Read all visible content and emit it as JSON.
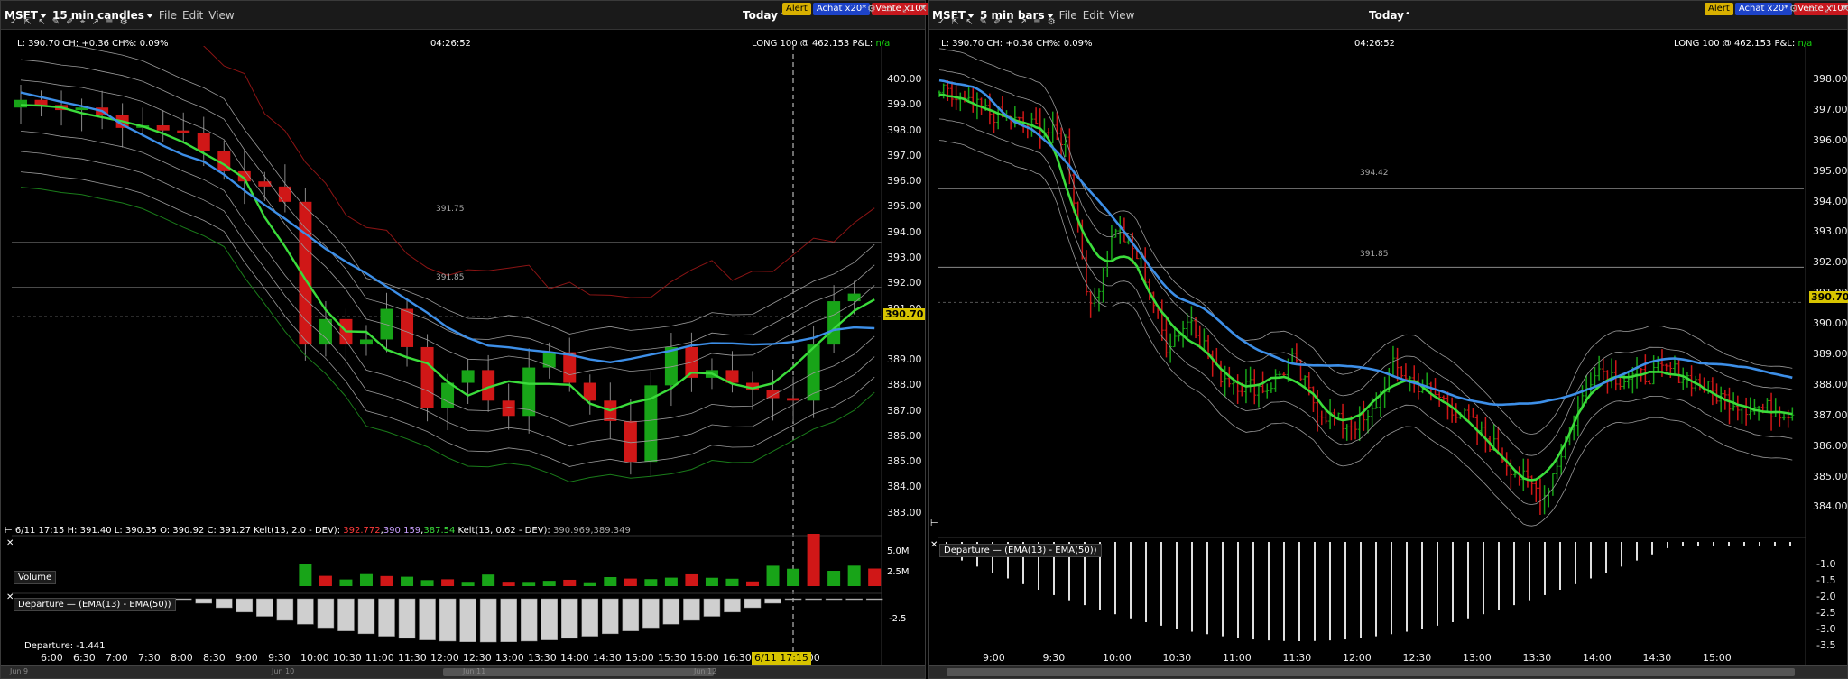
{
  "left": {
    "symbol": "MSFT",
    "period": "15 min candles",
    "menu": [
      "File",
      "Edit",
      "View"
    ],
    "today": "Today",
    "buttons": {
      "alert": "Alert",
      "buy": "Achat x20*",
      "sell": "Vente x10*"
    },
    "info_left": "L: 390.70 CH: +0.36 CH%: 0.09%",
    "time": "04:26:52",
    "position": "LONG 100 @ 462.153 P&L:",
    "pnl": "n/a",
    "price_tag": "390.70",
    "yaxis": [
      "400.00",
      "399.00",
      "398.00",
      "397.00",
      "396.00",
      "395.00",
      "394.00",
      "393.00",
      "392.00",
      "391.00",
      "389.00",
      "388.00",
      "387.00",
      "386.00",
      "385.00",
      "384.00",
      "383.00"
    ],
    "level_labels": [
      "391.75",
      "391.85"
    ],
    "ohlc_line": "6/11 17:15 H: 391.40 L: 390.35 O: 390.92 C: 391.27 Kelt(13, 2.0 - DEV):",
    "kelt1_vals": [
      "392.772",
      "390.159",
      "387.54"
    ],
    "kelt2_label": "Kelt(13, 0.62 - DEV):",
    "kelt2_vals": "390.969,389.349",
    "volume_label": "Volume",
    "volume_axis": [
      "5.0M",
      "2.5M"
    ],
    "departure_label": "Departure",
    "departure_formula": "(EMA(13) - EMA(50))",
    "departure_axis": "-2.5",
    "departure_value": "Departure: -1.441",
    "xaxis": [
      "6:00",
      "6:30",
      "7:00",
      "7:30",
      "8:00",
      "8:30",
      "9:00",
      "9:30",
      "10:00",
      "10:30",
      "11:00",
      "11:30",
      "12:00",
      "12:30",
      "13:00",
      "13:30",
      "14:00",
      "14:30",
      "15:00",
      "15:30",
      "16:00",
      "16:30",
      "18:00"
    ],
    "date_tag": "6/11 17:15",
    "scroll_dates": [
      "Jun 9",
      "Jun 10",
      "Jun 11",
      "Jun 12"
    ],
    "colors": {
      "up": "#18a418",
      "down": "#d01717",
      "ema_green": "#3bdc3b",
      "ema_blue": "#3d8fe8",
      "kelt": "#9a9a9a",
      "kelt_outer_red": "#8c1414",
      "kelt_outer_green": "#1a7c1a"
    }
  },
  "right": {
    "symbol": "MSFT",
    "period": "5 min bars",
    "menu": [
      "File",
      "Edit",
      "View"
    ],
    "today": "Today",
    "buttons": {
      "alert": "Alert",
      "buy": "Achat x20*",
      "sell": "Vente x10*"
    },
    "info_left": "L: 390.70 CH: +0.36 CH%: 0.09%",
    "time": "04:26:52",
    "position": "LONG 100 @ 462.153 P&L:",
    "pnl": "n/a",
    "price_tag": "390.70",
    "yaxis": [
      "398.00",
      "397.00",
      "396.00",
      "395.00",
      "394.00",
      "393.00",
      "392.00",
      "391.00",
      "390.00",
      "389.00",
      "388.00",
      "387.00",
      "386.00",
      "385.00",
      "384.00"
    ],
    "level_labels": [
      "394.42",
      "391.85"
    ],
    "departure_label": "Departure",
    "departure_formula": "(EMA(13) - EMA(50))",
    "departure_axis": [
      "-1.0",
      "-1.5",
      "-2.0",
      "-2.5",
      "-3.0",
      "-3.5"
    ],
    "xaxis": [
      "9:00",
      "9:30",
      "10:00",
      "10:30",
      "11:00",
      "11:30",
      "12:00",
      "12:30",
      "13:00",
      "13:30",
      "14:00",
      "14:30",
      "15:00"
    ]
  }
}
